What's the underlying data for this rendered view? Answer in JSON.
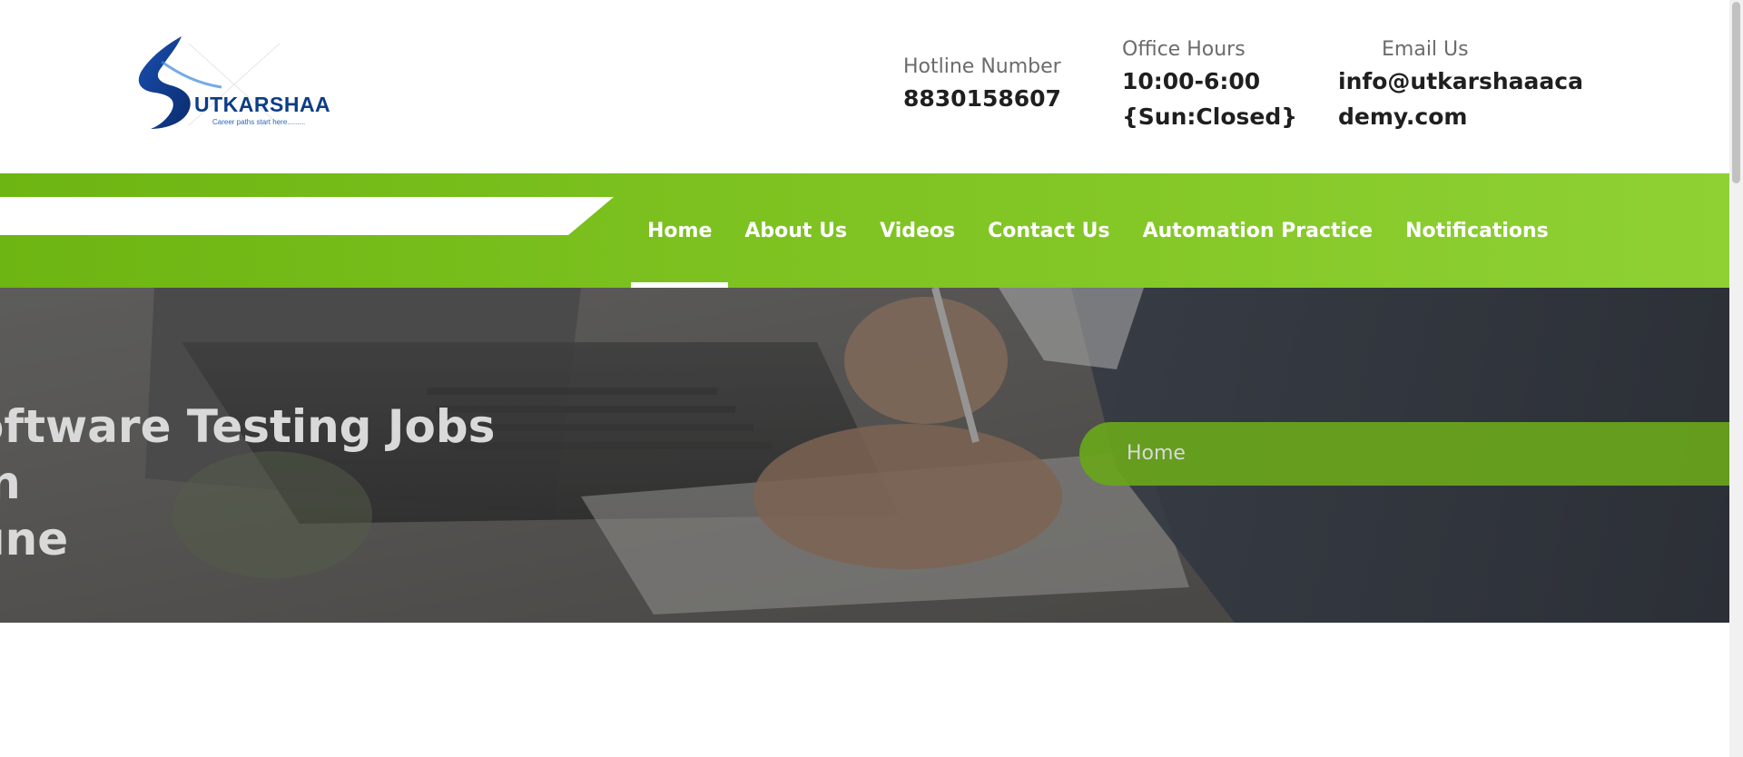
{
  "brand": {
    "name": "UTKARSHAA",
    "tagline": "Career paths start here.........",
    "logo_color": "#0c3d86"
  },
  "contacts": {
    "hotline": {
      "label": "Hotline Number",
      "value": "8830158607"
    },
    "hours": {
      "label": "Office Hours",
      "line1": "10:00-6:00",
      "line2": "{Sun:Closed}"
    },
    "email": {
      "label": "Email Us",
      "line1": "info@utkarshaaaca",
      "line2": "demy.com"
    }
  },
  "nav": {
    "items": [
      {
        "label": "Home",
        "active": true
      },
      {
        "label": "About Us",
        "active": false
      },
      {
        "label": "Videos",
        "active": false
      },
      {
        "label": "Contact Us",
        "active": false
      },
      {
        "label": "Automation Practice",
        "active": false
      },
      {
        "label": "Notifications",
        "active": false
      }
    ],
    "accent": "#7cc11f"
  },
  "hero": {
    "title_line1": "oftware Testing Jobs in",
    "title_line2": "une",
    "breadcrumb": "Home"
  }
}
